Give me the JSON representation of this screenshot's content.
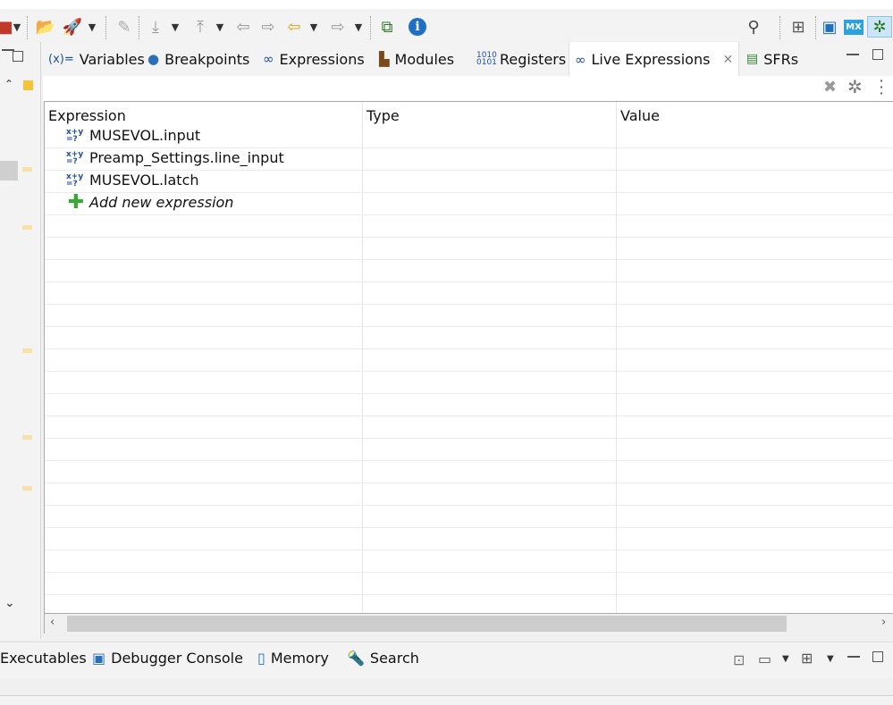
{
  "views": {
    "tabs": [
      {
        "label": "Variables",
        "icon": "variables-icon",
        "icon_glyph": "(x)="
      },
      {
        "label": "Breakpoints",
        "icon": "breakpoints-icon"
      },
      {
        "label": "Expressions",
        "icon": "expressions-icon"
      },
      {
        "label": "Modules",
        "icon": "modules-icon"
      },
      {
        "label": "Registers",
        "icon": "registers-icon",
        "icon_glyph": "1010"
      },
      {
        "label": "Live Expressions",
        "icon": "live-expressions-icon",
        "active": true
      },
      {
        "label": "SFRs",
        "icon": "sfrs-icon"
      }
    ]
  },
  "table": {
    "columns": [
      "Expression",
      "Type",
      "Value"
    ],
    "rows": [
      {
        "expression": "MUSEVOL.input",
        "type": "",
        "value": ""
      },
      {
        "expression": "Preamp_Settings.line_input",
        "type": "",
        "value": ""
      },
      {
        "expression": "MUSEVOL.latch",
        "type": "",
        "value": ""
      }
    ],
    "add_new": "Add new expression"
  },
  "bottom_tabs": [
    {
      "label": "Executables",
      "icon": ""
    },
    {
      "label": "Debugger Console",
      "icon": "debugger-console-icon"
    },
    {
      "label": "Memory",
      "icon": "memory-icon"
    },
    {
      "label": "Search",
      "icon": "search-icon"
    }
  ],
  "toolbar": {
    "mx_badge": "MX"
  },
  "colors": {
    "accent_blue": "#1f6fc5",
    "add_green": "#3aa837",
    "marker_yellow": "#f3c43a"
  }
}
